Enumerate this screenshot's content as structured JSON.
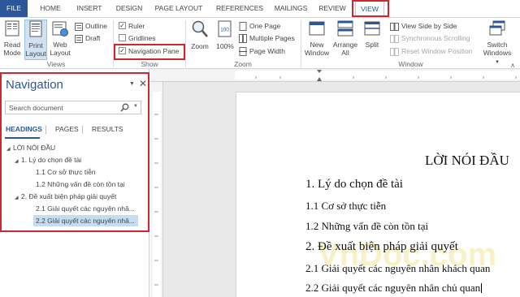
{
  "tabs": [
    "FILE",
    "HOME",
    "INSERT",
    "DESIGN",
    "PAGE LAYOUT",
    "REFERENCES",
    "MAILINGS",
    "REVIEW",
    "VIEW"
  ],
  "ribbon": {
    "views": {
      "read_mode": [
        "Read",
        "Mode"
      ],
      "print_layout": [
        "Print",
        "Layout"
      ],
      "web_layout": [
        "Web",
        "Layout"
      ],
      "outline": "Outline",
      "draft": "Draft",
      "group_label": "Views"
    },
    "show": {
      "ruler": "Ruler",
      "ruler_checked": true,
      "gridlines": "Gridlines",
      "gridlines_checked": false,
      "navigation_pane": "Navigation Pane",
      "navigation_pane_checked": true,
      "group_label": "Show"
    },
    "zoom": {
      "zoom": "Zoom",
      "hundred": "100%",
      "one_page": "One Page",
      "multiple_pages": "Multiple Pages",
      "page_width": "Page Width",
      "group_label": "Zoom"
    },
    "window": {
      "new_window": [
        "New",
        "Window"
      ],
      "arrange_all": [
        "Arrange",
        "All"
      ],
      "split": "Split",
      "side_by_side": "View Side by Side",
      "sync_scrolling": "Synchronous Scrolling",
      "reset_position": "Reset Window Position",
      "switch_windows": [
        "Switch",
        "Windows"
      ],
      "group_label": "Window"
    }
  },
  "nav": {
    "title": "Navigation",
    "search_placeholder": "Search document",
    "tabs": [
      "HEADINGS",
      "PAGES",
      "RESULTS"
    ],
    "tree": [
      {
        "text": "LỜI NÓI ĐẦU",
        "level": 0,
        "expanded": true
      },
      {
        "text": "1. Lý do chọn đề tài",
        "level": 1,
        "expanded": true
      },
      {
        "text": "1.1 Cơ sở thực tiễn",
        "level": 2
      },
      {
        "text": "1.2 Những vấn đề còn tồn tại",
        "level": 2
      },
      {
        "text": "2. Đề xuất biện pháp giải quyết",
        "level": 1,
        "expanded": true
      },
      {
        "text": "2.1 Giải quyết các nguyên nhâ...",
        "level": 2
      },
      {
        "text": "2.2 Giải quyết các nguyên nhâ...",
        "level": 2,
        "selected": true
      }
    ]
  },
  "document": {
    "title": "LỜI NÓI ĐẦU",
    "h1": "1.  Lý do chọn đề tài",
    "p11": "1.1 Cơ sở thực tiễn",
    "p12": "1.2 Những vấn đề còn tồn tại",
    "h2": "2.  Đề xuất biện pháp giải quyết",
    "p21": "2.1 Giải quyết các nguyên nhân khách quan",
    "p22": "2.2 Giải quyết các nguyên nhân chủ quan",
    "watermark": "VnDoc.com"
  },
  "colors": {
    "accent": "#2b579a",
    "highlight_box": "#d0262d",
    "selection": "#c5dcf2"
  }
}
